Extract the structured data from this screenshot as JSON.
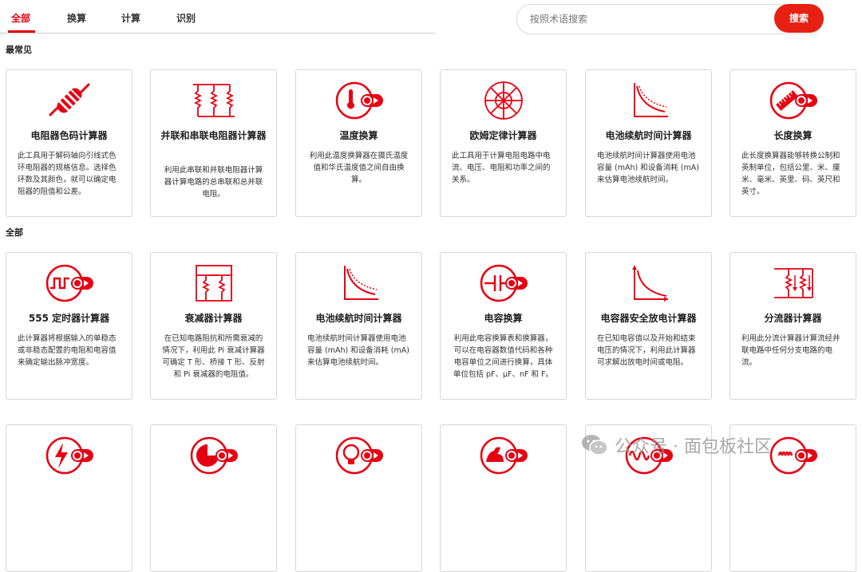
{
  "tabs": [
    "全部",
    "换算",
    "计算",
    "识别"
  ],
  "search": {
    "placeholder": "按照术语搜索",
    "button_label": "搜索"
  },
  "sections": {
    "common": "最常见",
    "all": "全部"
  },
  "colors": {
    "accent": "#e60012"
  },
  "cards": [
    {
      "icon": "resistor-icon",
      "title": "电阻器色码计算器",
      "desc": "此工具用于解码轴向引线式色环电阻器的规格信息。选择色环数及其颜色，就可以确定电阻器的阻值和公差。"
    },
    {
      "icon": "parallel-series-resistor-icon",
      "title": "并联和串联电阻器计算器",
      "desc": "利用此串联和并联电阻器计算器计算电路的总串联和总并联电阻。"
    },
    {
      "icon": "thermometer-convert-icon",
      "title": "温度换算",
      "desc": "利用此温度换算器在摄氏温度值和华氏温度值之间自由换算。"
    },
    {
      "icon": "ohms-law-wheel-icon",
      "title": "欧姆定律计算器",
      "desc": "此工具用于计算电阻电路中电流、电压、电阻和功率之间的关系。"
    },
    {
      "icon": "battery-discharge-curve-icon",
      "title": "电池续航时间计算器",
      "desc": "电池续航时间计算器使用电池容量 (mAh) 和设备消耗 (mA) 来估算电池续航时间。"
    },
    {
      "icon": "ruler-convert-icon",
      "title": "长度换算",
      "desc": "此长度换算器能够转换公制和英制单位，包括公里、米、厘米、毫米、英里、码、英尺和英寸。"
    },
    {
      "icon": "timer-555-icon",
      "title": "555 定时器计算器",
      "desc": "此计算器将根据输入的单稳态或非稳态配置的电阻和电容值来确定输出脉冲宽度。"
    },
    {
      "icon": "attenuator-icon",
      "title": "衰减器计算器",
      "desc": "在已知电路阻抗和所需衰减的情况下，利用此 Pi 衰减计算器可确定 T 形、桥接 T 形、反射和 Pi 衰减器的电阻值。"
    },
    {
      "icon": "battery-discharge-curve-icon",
      "title": "电池续航时间计算器",
      "desc": "电池续航时间计算器使用电池容量 (mAh) 和设备消耗 (mA) 来估算电池续航时间。"
    },
    {
      "icon": "capacitor-convert-icon",
      "title": "电容换算",
      "desc": "利用此电容换算表和换算器，可以在电容器数值代码和各种电容单位之间进行换算，具体单位包括 pF、μF、nF 和 F。"
    },
    {
      "icon": "capacitor-discharge-icon",
      "title": "电容器安全放电计算器",
      "desc": "在已知电容值以及开始和结束电压的情况下，利用此计算器可求解出放电时间或电阻。"
    },
    {
      "icon": "current-divider-icon",
      "title": "分流器计算器",
      "desc": "利用此分流计算器计算流经并联电路中任何分支电路的电流。"
    },
    {
      "icon": "power-bolt-icon",
      "title": "",
      "desc": ""
    },
    {
      "icon": "pie-convert-icon",
      "title": "",
      "desc": ""
    },
    {
      "icon": "lightbulb-convert-icon",
      "title": "",
      "desc": ""
    },
    {
      "icon": "muscle-convert-icon",
      "title": "",
      "desc": ""
    },
    {
      "icon": "wave-convert-icon",
      "title": "",
      "desc": ""
    },
    {
      "icon": "coil-convert-icon",
      "title": "",
      "desc": ""
    }
  ],
  "watermark": {
    "icon": "wechat-icon",
    "text": "公众号 · 面包板社区"
  }
}
